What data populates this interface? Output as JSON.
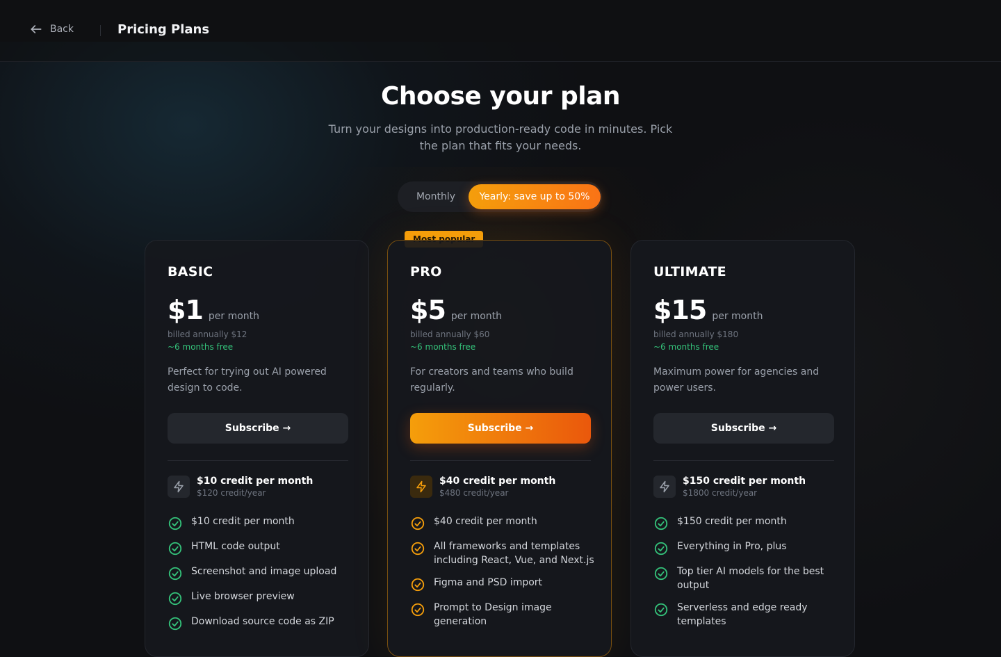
{
  "header": {
    "back_label": "Back",
    "title": "Pricing Plans"
  },
  "hero": {
    "title": "Choose your plan",
    "subtitle": "Turn your designs into production-ready code in minutes. Pick the plan that fits your needs."
  },
  "billing_toggle": {
    "monthly_label": "Monthly",
    "yearly_label": "Yearly: save up to 50%",
    "selected": "yearly"
  },
  "colors": {
    "accent": "#f59e0b",
    "accent_end": "#ea580c",
    "success": "#34c27a",
    "background": "#0f1013",
    "card": "#16181d"
  },
  "plans": [
    {
      "name": "BASIC",
      "price": "$1",
      "per": "per month",
      "billed": "billed annually $12",
      "free": "~6 months free",
      "description": "Perfect for trying out AI powered design to code.",
      "cta": "Subscribe →",
      "credit_title": "$10 credit per month",
      "credit_sub": "$120 credit/year",
      "features": [
        "$10 credit per month",
        "HTML code output",
        "Screenshot and image upload",
        "Live browser preview",
        "Download source code as ZIP"
      ]
    },
    {
      "name": "PRO",
      "badge": "Most popular",
      "price": "$5",
      "per": "per month",
      "billed": "billed annually $60",
      "free": "~6 months free",
      "description": "For creators and teams who build regularly.",
      "cta": "Subscribe →",
      "credit_title": "$40 credit per month",
      "credit_sub": "$480 credit/year",
      "features": [
        "$40 credit per month",
        "All frameworks and templates including React, Vue, and Next.js",
        "Figma and PSD import",
        "Prompt to Design image generation"
      ]
    },
    {
      "name": "ULTIMATE",
      "price": "$15",
      "per": "per month",
      "billed": "billed annually $180",
      "free": "~6 months free",
      "description": "Maximum power for agencies and power users.",
      "cta": "Subscribe →",
      "credit_title": "$150 credit per month",
      "credit_sub": "$1800 credit/year",
      "features": [
        "$150 credit per month",
        "Everything in Pro, plus",
        "Top tier AI models for the best output",
        "Serverless and edge ready templates"
      ]
    }
  ]
}
